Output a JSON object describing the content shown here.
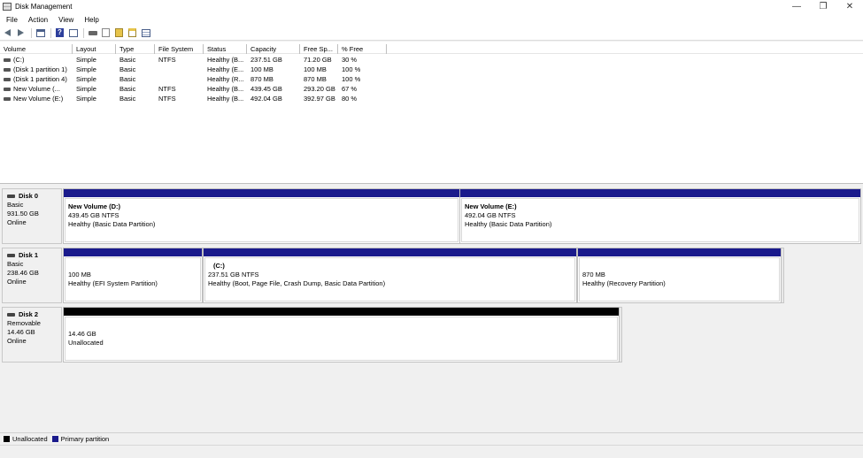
{
  "window": {
    "title": "Disk Management",
    "controls": {
      "minimize": "—",
      "maximize": "❐",
      "close": "✕"
    }
  },
  "menu": [
    "File",
    "Action",
    "View",
    "Help"
  ],
  "volumes": {
    "columns": [
      "Volume",
      "Layout",
      "Type",
      "File System",
      "Status",
      "Capacity",
      "Free Sp...",
      "% Free"
    ],
    "rows": [
      {
        "volume": "(C:)",
        "layout": "Simple",
        "type": "Basic",
        "fs": "NTFS",
        "status": "Healthy (B...",
        "capacity": "237.51 GB",
        "free": "71.20 GB",
        "pct": "30 %"
      },
      {
        "volume": "(Disk 1 partition 1)",
        "layout": "Simple",
        "type": "Basic",
        "fs": "",
        "status": "Healthy (E...",
        "capacity": "100 MB",
        "free": "100 MB",
        "pct": "100 %"
      },
      {
        "volume": "(Disk 1 partition 4)",
        "layout": "Simple",
        "type": "Basic",
        "fs": "",
        "status": "Healthy (R...",
        "capacity": "870 MB",
        "free": "870 MB",
        "pct": "100 %"
      },
      {
        "volume": "New Volume (...",
        "layout": "Simple",
        "type": "Basic",
        "fs": "NTFS",
        "status": "Healthy (B...",
        "capacity": "439.45 GB",
        "free": "293.20 GB",
        "pct": "67 %"
      },
      {
        "volume": "New Volume (E:)",
        "layout": "Simple",
        "type": "Basic",
        "fs": "NTFS",
        "status": "Healthy (B...",
        "capacity": "492.04 GB",
        "free": "392.97 GB",
        "pct": "80 %"
      }
    ]
  },
  "disks": [
    {
      "name": "Disk 0",
      "kind": "Basic",
      "size": "931.50 GB",
      "state": "Online",
      "partitions": [
        {
          "name": "New Volume  (D:)",
          "size": "439.45 GB NTFS",
          "status": "Healthy (Basic Data Partition)",
          "bar": "primary"
        },
        {
          "name": "New Volume  (E:)",
          "size": "492.04 GB NTFS",
          "status": "Healthy (Basic Data Partition)",
          "bar": "primary"
        }
      ]
    },
    {
      "name": "Disk 1",
      "kind": "Basic",
      "size": "238.46 GB",
      "state": "Online",
      "partitions": [
        {
          "name": "",
          "size": "100 MB",
          "status": "Healthy (EFI System Partition)",
          "bar": "primary"
        },
        {
          "name": "(C:)",
          "size": "237.51 GB NTFS",
          "status": "Healthy (Boot, Page File, Crash Dump, Basic Data Partition)",
          "bar": "primary"
        },
        {
          "name": "",
          "size": "870 MB",
          "status": "Healthy (Recovery Partition)",
          "bar": "primary"
        }
      ]
    },
    {
      "name": "Disk 2",
      "kind": "Removable",
      "size": "14.46 GB",
      "state": "Online",
      "partitions": [
        {
          "name": "",
          "size": "14.46 GB",
          "status": "Unallocated",
          "bar": "unalloc"
        }
      ]
    }
  ],
  "legend": [
    {
      "label": "Unallocated",
      "color": "#000000"
    },
    {
      "label": "Primary partition",
      "color": "#1a1a8c"
    }
  ]
}
